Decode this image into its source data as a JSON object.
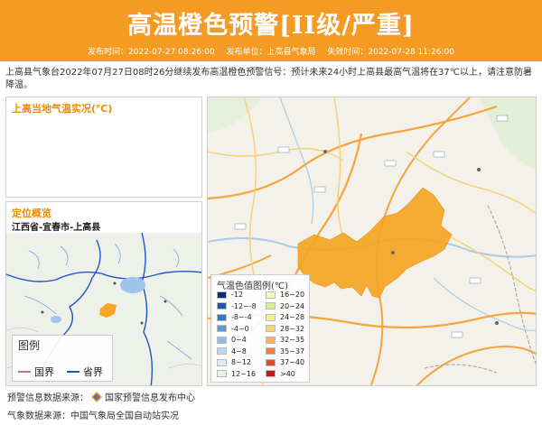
{
  "header": {
    "title": "高温橙色预警[II级/严重]",
    "issue_time": "发布时间：2022-07-27 08:26:00",
    "issuer": "发布单位：上高县气象局",
    "expire_time": "失效时间：2022-07-28 11:26:00",
    "color": "#f59a23"
  },
  "description": "上高县气象台2022年07月27日08时26分继续发布高温橙色预警信号：预计未来24小时上高县最高气温将在37℃以上，请注意防暑降温。",
  "temperature_panel": {
    "title": "上高当地气温实况(℃)"
  },
  "location_panel": {
    "title": "定位概览",
    "location": "江西省-宜春市-上高县",
    "legend_title": "图例",
    "legend_items": [
      {
        "label": "国界",
        "color": "#d4707e"
      },
      {
        "label": "省界",
        "color": "#1f55c8"
      }
    ]
  },
  "map": {
    "legend_title": "气温色值图例(℃)",
    "legend_items": [
      {
        "label": "-12",
        "color": "#0a2e7c"
      },
      {
        "label": "16~20",
        "color": "#f3f9b8"
      },
      {
        "label": "-12~-8",
        "color": "#1e56a8"
      },
      {
        "label": "20~24",
        "color": "#dbef8e"
      },
      {
        "label": "-8~-4",
        "color": "#3479c4"
      },
      {
        "label": "24~28",
        "color": "#f9ec8a"
      },
      {
        "label": "-4~0",
        "color": "#5c9ad6"
      },
      {
        "label": "28~32",
        "color": "#fbd474"
      },
      {
        "label": "0~4",
        "color": "#8cbde8"
      },
      {
        "label": "32~35",
        "color": "#f9b25a"
      },
      {
        "label": "4~8",
        "color": "#b9d9f3"
      },
      {
        "label": "35~37",
        "color": "#f47f3a"
      },
      {
        "label": "8~12",
        "color": "#dcecf8"
      },
      {
        "label": "37~40",
        "color": "#e8492b"
      },
      {
        "label": "12~16",
        "color": "#e6f5e1"
      },
      {
        "label": ">40",
        "color": "#c81a1a"
      }
    ],
    "region_color": "#f5a623"
  },
  "footer": {
    "warning_source": "预警信息数据来源：",
    "warning_source_name": "国家预警信息发布中心",
    "weather_source": "气象数据来源：中国气象局全国自动站实况"
  }
}
